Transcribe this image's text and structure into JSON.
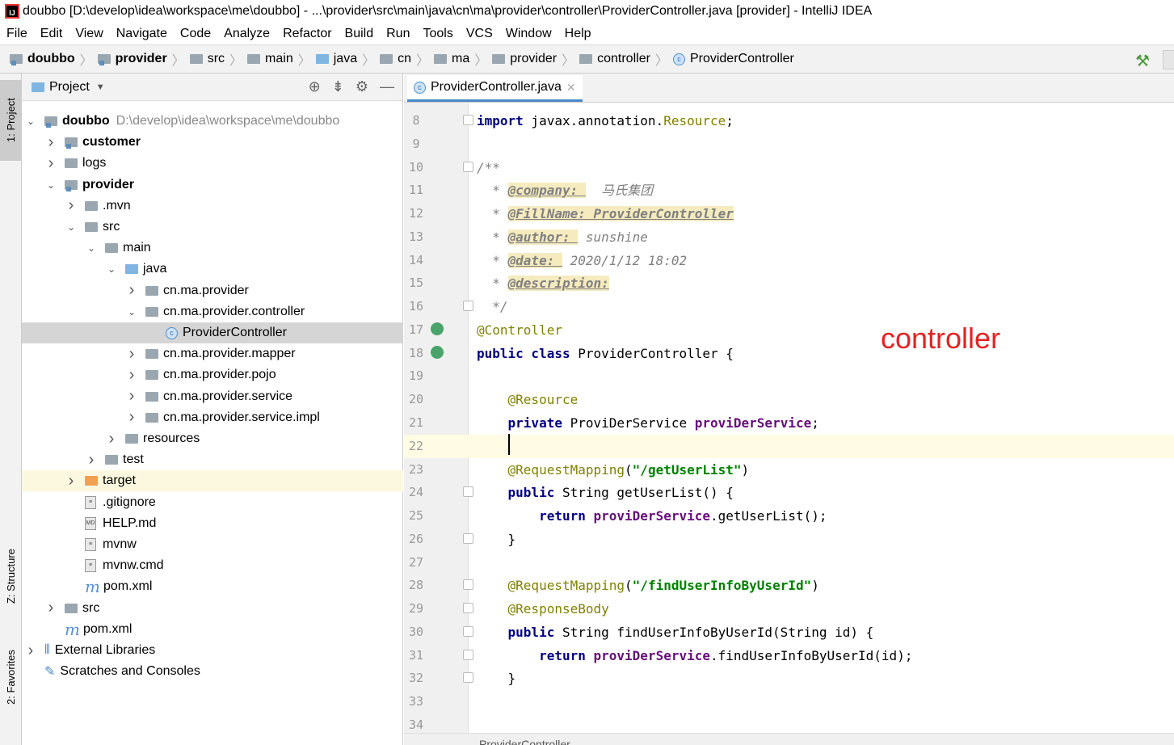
{
  "title": "doubbo [D:\\develop\\idea\\workspace\\me\\doubbo] - ...\\provider\\src\\main\\java\\cn\\ma\\provider\\controller\\ProviderController.java [provider] - IntelliJ IDEA",
  "menu": [
    "File",
    "Edit",
    "View",
    "Navigate",
    "Code",
    "Analyze",
    "Refactor",
    "Build",
    "Run",
    "Tools",
    "VCS",
    "Window",
    "Help"
  ],
  "breadcrumbs": [
    {
      "label": "doubbo",
      "bold": true,
      "icon": "module-folder"
    },
    {
      "label": "provider",
      "bold": true,
      "icon": "module-folder"
    },
    {
      "label": "src",
      "icon": "folder"
    },
    {
      "label": "main",
      "icon": "folder"
    },
    {
      "label": "java",
      "icon": "source-folder"
    },
    {
      "label": "cn",
      "icon": "folder"
    },
    {
      "label": "ma",
      "icon": "folder"
    },
    {
      "label": "provider",
      "icon": "folder"
    },
    {
      "label": "controller",
      "icon": "folder"
    },
    {
      "label": "ProviderController",
      "icon": "class"
    }
  ],
  "side_tabs": {
    "project": "1: Project",
    "structure": "Z: Structure",
    "favorites": "2: Favorites"
  },
  "panel": {
    "title": "Project"
  },
  "tree": [
    {
      "label": "doubbo",
      "path": "D:\\develop\\idea\\workspace\\me\\doubbo",
      "level": 0,
      "arrow": "down",
      "icon": "module",
      "bold": true
    },
    {
      "label": "customer",
      "level": 1,
      "arrow": "right",
      "icon": "module",
      "bold": true
    },
    {
      "label": "logs",
      "level": 1,
      "arrow": "right",
      "icon": "folder"
    },
    {
      "label": "provider",
      "level": 1,
      "arrow": "down",
      "icon": "module",
      "bold": true
    },
    {
      "label": ".mvn",
      "level": 2,
      "arrow": "right",
      "icon": "folder"
    },
    {
      "label": "src",
      "level": 2,
      "arrow": "down",
      "icon": "folder"
    },
    {
      "label": "main",
      "level": 3,
      "arrow": "down",
      "icon": "folder"
    },
    {
      "label": "java",
      "level": 4,
      "arrow": "down",
      "icon": "source"
    },
    {
      "label": "cn.ma.provider",
      "level": 5,
      "arrow": "right",
      "icon": "folder"
    },
    {
      "label": "cn.ma.provider.controller",
      "level": 5,
      "arrow": "down",
      "icon": "folder"
    },
    {
      "label": "ProviderController",
      "level": 6,
      "arrow": "",
      "icon": "class",
      "selected": true
    },
    {
      "label": "cn.ma.provider.mapper",
      "level": 5,
      "arrow": "right",
      "icon": "folder"
    },
    {
      "label": "cn.ma.provider.pojo",
      "level": 5,
      "arrow": "right",
      "icon": "folder"
    },
    {
      "label": "cn.ma.provider.service",
      "level": 5,
      "arrow": "right",
      "icon": "folder"
    },
    {
      "label": "cn.ma.provider.service.impl",
      "level": 5,
      "arrow": "right",
      "icon": "folder"
    },
    {
      "label": "resources",
      "level": 4,
      "arrow": "right",
      "icon": "folder"
    },
    {
      "label": "test",
      "level": 3,
      "arrow": "right",
      "icon": "folder"
    },
    {
      "label": "target",
      "level": 2,
      "arrow": "right",
      "icon": "excluded",
      "highlight": true
    },
    {
      "label": ".gitignore",
      "level": 2,
      "arrow": "",
      "icon": "file"
    },
    {
      "label": "HELP.md",
      "level": 2,
      "arrow": "",
      "icon": "md"
    },
    {
      "label": "mvnw",
      "level": 2,
      "arrow": "",
      "icon": "file"
    },
    {
      "label": "mvnw.cmd",
      "level": 2,
      "arrow": "",
      "icon": "file"
    },
    {
      "label": "pom.xml",
      "level": 2,
      "arrow": "",
      "icon": "maven"
    },
    {
      "label": "src",
      "level": 1,
      "arrow": "right",
      "icon": "folder"
    },
    {
      "label": "pom.xml",
      "level": 1,
      "arrow": "",
      "icon": "maven"
    },
    {
      "label": "External Libraries",
      "level": 0,
      "arrow": "right",
      "icon": "libs"
    },
    {
      "label": "Scratches and Consoles",
      "level": 0,
      "arrow": "",
      "icon": "scratch"
    }
  ],
  "editor": {
    "tab": "ProviderController.java",
    "current_line": 22,
    "lines": [
      {
        "n": 8,
        "t": [
          [
            "import",
            "kw"
          ],
          [
            " javax.annotation.",
            ""
          ],
          [
            "Resource",
            "res"
          ],
          [
            ";",
            ""
          ]
        ]
      },
      {
        "n": 9,
        "t": []
      },
      {
        "n": 10,
        "t": [
          [
            "/**",
            "cm"
          ]
        ]
      },
      {
        "n": 11,
        "t": [
          [
            "  * ",
            "cm"
          ],
          [
            "@company: ",
            "tag"
          ],
          [
            "  马氏集团",
            "cm"
          ]
        ]
      },
      {
        "n": 12,
        "t": [
          [
            "  * ",
            "cm"
          ],
          [
            "@FillName: ProviderController",
            "tag"
          ]
        ]
      },
      {
        "n": 13,
        "t": [
          [
            "  * ",
            "cm"
          ],
          [
            "@author: ",
            "tag"
          ],
          [
            " sunshine",
            "cm"
          ]
        ]
      },
      {
        "n": 14,
        "t": [
          [
            "  * ",
            "cm"
          ],
          [
            "@date: ",
            "tag"
          ],
          [
            " 2020/1/12 18:02",
            "cm"
          ]
        ]
      },
      {
        "n": 15,
        "t": [
          [
            "  * ",
            "cm"
          ],
          [
            "@description:",
            "tag"
          ]
        ]
      },
      {
        "n": 16,
        "t": [
          [
            "  */",
            "cm"
          ]
        ]
      },
      {
        "n": 17,
        "t": [
          [
            "@Controller",
            "ann"
          ]
        ]
      },
      {
        "n": 18,
        "t": [
          [
            "public class",
            "kw"
          ],
          [
            " ProviderController {",
            ""
          ]
        ]
      },
      {
        "n": 19,
        "t": []
      },
      {
        "n": 20,
        "t": [
          [
            "    ",
            ""
          ],
          [
            "@Resource",
            "ann"
          ]
        ]
      },
      {
        "n": 21,
        "t": [
          [
            "    ",
            ""
          ],
          [
            "private",
            "kw"
          ],
          [
            " ProviDerService ",
            ""
          ],
          [
            "proviDerService",
            "fld"
          ],
          [
            ";",
            ""
          ]
        ]
      },
      {
        "n": 22,
        "t": []
      },
      {
        "n": 23,
        "t": [
          [
            "    ",
            ""
          ],
          [
            "@RequestMapping",
            "ann"
          ],
          [
            "(",
            ""
          ],
          [
            "\"/getUserList\"",
            "str"
          ],
          [
            ")",
            ""
          ]
        ]
      },
      {
        "n": 24,
        "t": [
          [
            "    ",
            ""
          ],
          [
            "public",
            "kw"
          ],
          [
            " String getUserList() {",
            ""
          ]
        ]
      },
      {
        "n": 25,
        "t": [
          [
            "        ",
            ""
          ],
          [
            "return",
            "kw"
          ],
          [
            " ",
            ""
          ],
          [
            "proviDerService",
            "fld"
          ],
          [
            ".getUserList();",
            ""
          ]
        ]
      },
      {
        "n": 26,
        "t": [
          [
            "    }",
            ""
          ]
        ]
      },
      {
        "n": 27,
        "t": []
      },
      {
        "n": 28,
        "t": [
          [
            "    ",
            ""
          ],
          [
            "@RequestMapping",
            "ann"
          ],
          [
            "(",
            ""
          ],
          [
            "\"/findUserInfoByUserId\"",
            "str"
          ],
          [
            ")",
            ""
          ]
        ]
      },
      {
        "n": 29,
        "t": [
          [
            "    ",
            ""
          ],
          [
            "@ResponseBody",
            "ann"
          ]
        ]
      },
      {
        "n": 30,
        "t": [
          [
            "    ",
            ""
          ],
          [
            "public",
            "kw"
          ],
          [
            " String findUserInfoByUserId(String id) {",
            ""
          ]
        ]
      },
      {
        "n": 31,
        "t": [
          [
            "        ",
            ""
          ],
          [
            "return",
            "kw"
          ],
          [
            " ",
            ""
          ],
          [
            "proviDerService",
            "fld"
          ],
          [
            ".findUserInfoByUserId(id);",
            ""
          ]
        ]
      },
      {
        "n": 32,
        "t": [
          [
            "    }",
            ""
          ]
        ]
      },
      {
        "n": 33,
        "t": []
      },
      {
        "n": 34,
        "t": []
      }
    ],
    "breadcrumb": "ProviderController"
  },
  "overlay_text": "controller"
}
